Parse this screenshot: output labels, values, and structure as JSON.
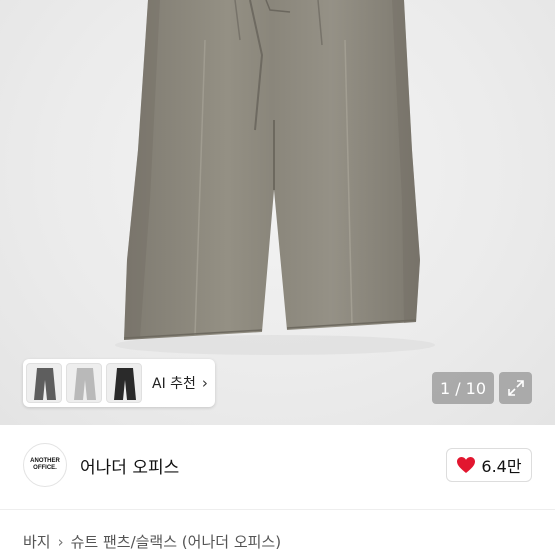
{
  "gallery": {
    "thumbnails": [
      {
        "name": "thumb-dark-gray",
        "color": "#5e5e5e"
      },
      {
        "name": "thumb-light-gray",
        "color": "#b9b9b9"
      },
      {
        "name": "thumb-black",
        "color": "#2a2a2a"
      }
    ],
    "ai_recommend_label": "AI 추천",
    "pager_text": "1 / 10",
    "current_page": 1,
    "total_pages": 10,
    "product_color": "#8e8a7f"
  },
  "brand": {
    "logo_line1": "ANOTHER",
    "logo_line2": "OFFICE.",
    "name": "어나더 오피스",
    "like_count": "6.4만",
    "like_color": "#e2162f"
  },
  "breadcrumb": {
    "level1": "바지",
    "level2": "슈트 팬츠/슬랙스 (어나더 오피스)"
  }
}
